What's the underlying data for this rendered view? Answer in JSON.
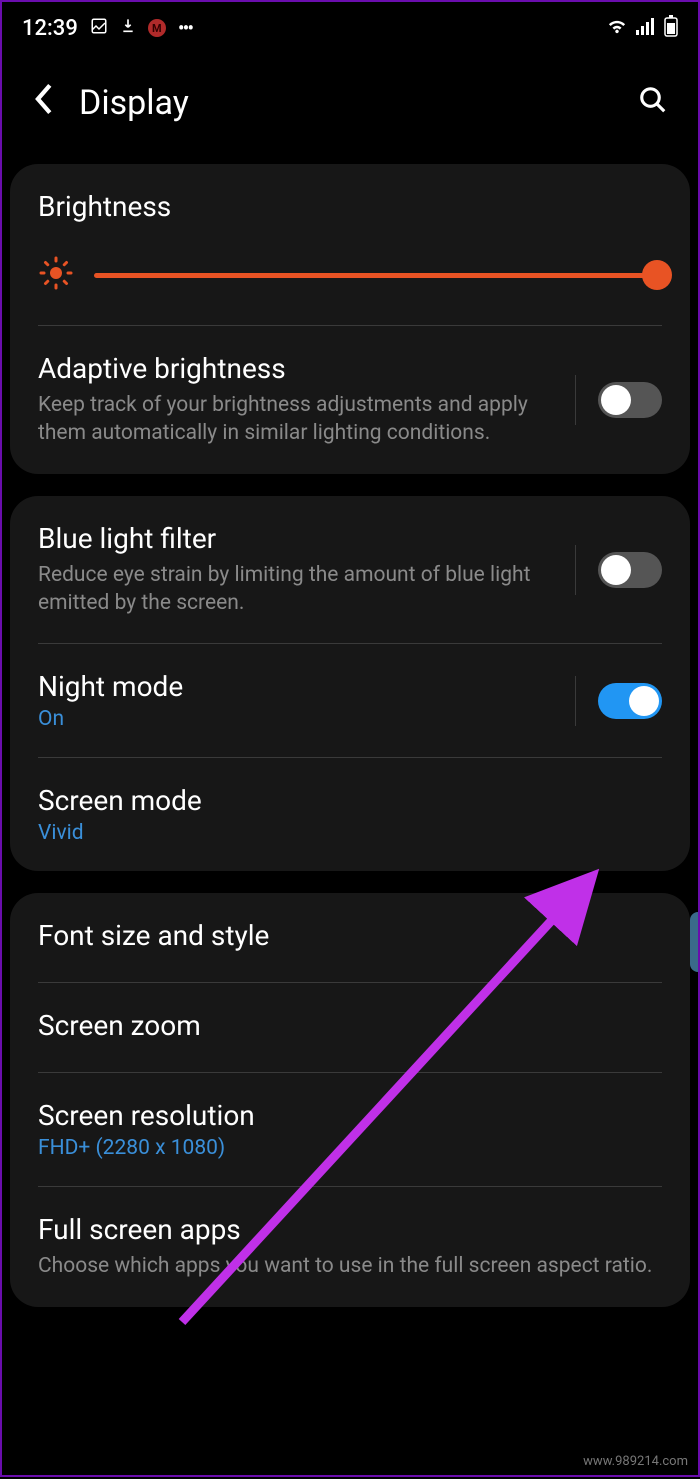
{
  "status_bar": {
    "time": "12:39",
    "icons": {
      "image": "image-icon",
      "download": "download-icon",
      "app": "M",
      "dots": "⋯"
    },
    "right": {
      "wifi": "wifi-icon",
      "signal": "signal-icon",
      "battery": "battery-icon"
    }
  },
  "header": {
    "title": "Display"
  },
  "brightness": {
    "title": "Brightness",
    "value": 100
  },
  "adaptive_brightness": {
    "title": "Adaptive brightness",
    "desc": "Keep track of your brightness adjustments and apply them automatically in similar lighting conditions.",
    "enabled": false
  },
  "blue_light": {
    "title": "Blue light filter",
    "desc": "Reduce eye strain by limiting the amount of blue light emitted by the screen.",
    "enabled": false
  },
  "night_mode": {
    "title": "Night mode",
    "value": "On",
    "enabled": true
  },
  "screen_mode": {
    "title": "Screen mode",
    "value": "Vivid"
  },
  "font_style": {
    "title": "Font size and style"
  },
  "screen_zoom": {
    "title": "Screen zoom"
  },
  "screen_resolution": {
    "title": "Screen resolution",
    "value": "FHD+ (2280 x 1080)"
  },
  "full_screen_apps": {
    "title": "Full screen apps",
    "desc": "Choose which apps you want to use in the full screen aspect ratio."
  },
  "watermark": "www.989214.com"
}
